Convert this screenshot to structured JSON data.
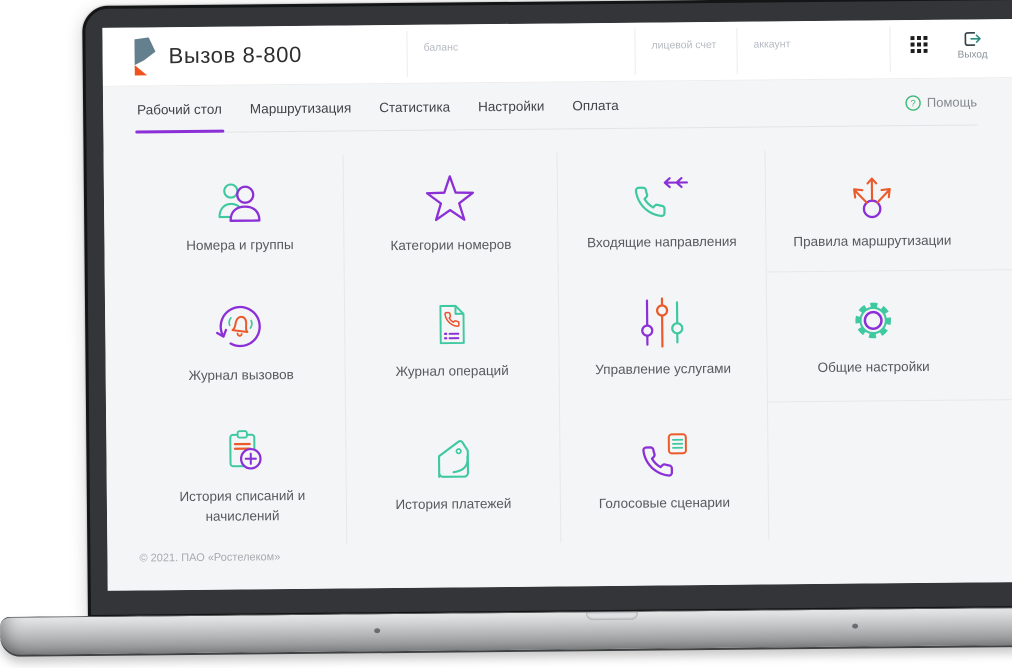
{
  "header": {
    "app_title": "Вызов 8-800",
    "sections": [
      {
        "label": "баланс"
      },
      {
        "label": "лицевой счет"
      },
      {
        "label": "аккаунт"
      }
    ],
    "logout_label": "Выход"
  },
  "nav": {
    "tabs": [
      {
        "label": "Рабочий стол",
        "active": true
      },
      {
        "label": "Маршрутизация",
        "active": false
      },
      {
        "label": "Статистика",
        "active": false
      },
      {
        "label": "Настройки",
        "active": false
      },
      {
        "label": "Оплата",
        "active": false
      }
    ],
    "help_label": "Помощь"
  },
  "tiles": [
    {
      "label": "Номера и группы",
      "icon": "people-icon"
    },
    {
      "label": "Категории номеров",
      "icon": "star-icon"
    },
    {
      "label": "Входящие направления",
      "icon": "incoming-phone-icon"
    },
    {
      "label": "Правила маршрутизации",
      "icon": "routing-arrows-icon"
    },
    {
      "label": "Журнал вызовов",
      "icon": "call-log-icon"
    },
    {
      "label": "Журнал операций",
      "icon": "operations-log-icon"
    },
    {
      "label": "Управление услугами",
      "icon": "sliders-icon"
    },
    {
      "label": "Общие настройки",
      "icon": "gear-icon"
    },
    {
      "label": "История списаний и начислений",
      "icon": "clipboard-plus-icon"
    },
    {
      "label": "История платежей",
      "icon": "wallet-icon"
    },
    {
      "label": "Голосовые сценарии",
      "icon": "voice-script-icon"
    }
  ],
  "footer": {
    "copyright": "© 2021. ПАО «Ростелеком»"
  },
  "colors": {
    "purple": "#8b2fd6",
    "teal": "#3fc9a0",
    "orange": "#eb5a2b",
    "help_green": "#3cb878",
    "tab_underline": "#8b2fd6",
    "logo_gray": "#64808f",
    "logo_orange": "#f0521e"
  }
}
